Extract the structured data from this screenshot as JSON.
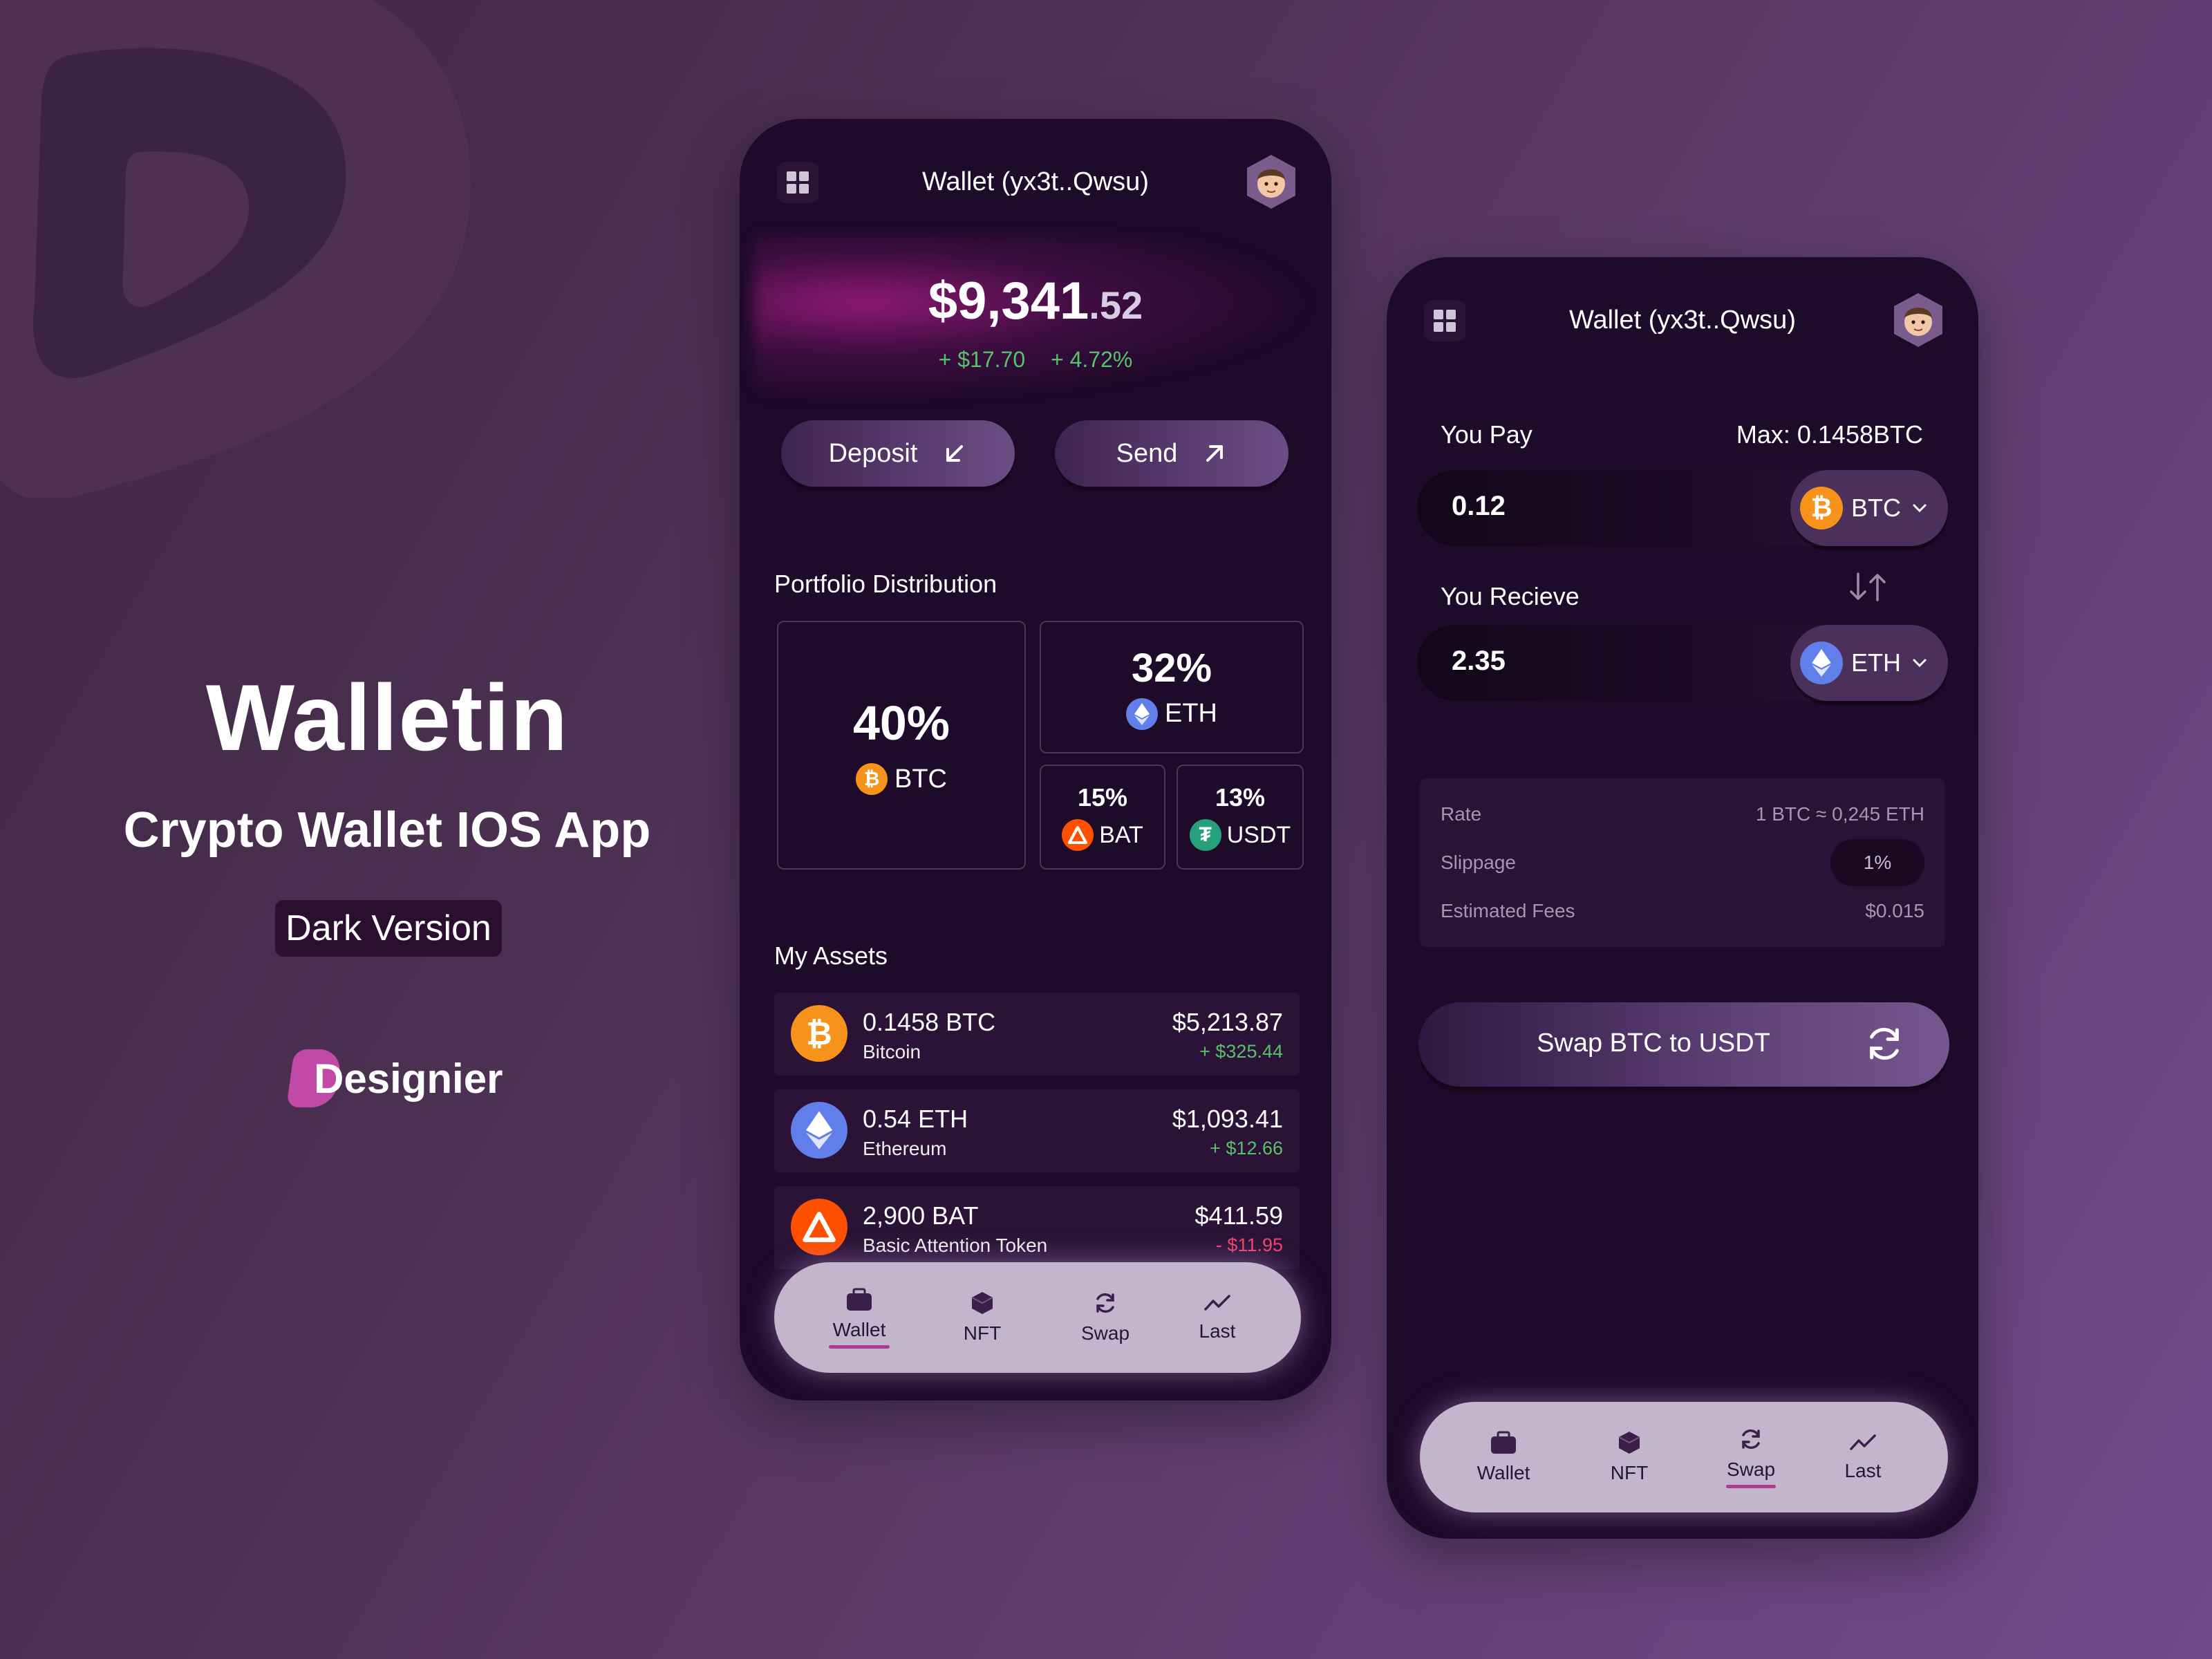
{
  "brand": {
    "title": "Walletin",
    "subtitle": "Crypto Wallet IOS App",
    "version": "Dark Version",
    "designer": "Designier"
  },
  "colors": {
    "background_start": "#3f2841",
    "background_end": "#6f4a8a",
    "phone_bg": "#1e0a29",
    "positive": "#56c26a",
    "negative": "#f0456b",
    "accent": "#b03c92",
    "btc": "#f7931a",
    "eth": "#627eea",
    "bat": "#ff5000",
    "usdt": "#26a17b"
  },
  "wallet_screen": {
    "header": {
      "title": "Wallet (yx3t..Qwsu)",
      "menu_icon": "grid-icon",
      "avatar_icon": "avatar"
    },
    "balance": {
      "main": "$9,341",
      "cents": ".52",
      "change_amount": "+ $17.70",
      "change_percent": "+ 4.72%"
    },
    "actions": {
      "deposit_label": "Deposit",
      "send_label": "Send"
    },
    "portfolio": {
      "title": "Portfolio Distribution",
      "items": [
        {
          "percent": "40%",
          "symbol": "BTC"
        },
        {
          "percent": "32%",
          "symbol": "ETH"
        },
        {
          "percent": "15%",
          "symbol": "BAT"
        },
        {
          "percent": "13%",
          "symbol": "USDT"
        }
      ]
    },
    "assets": {
      "title": "My Assets",
      "items": [
        {
          "amount": "0.1458 BTC",
          "name": "Bitcoin",
          "value": "$5,213.87",
          "change": "+ $325.44"
        },
        {
          "amount": "0.54 ETH",
          "name": "Ethereum",
          "value": "$1,093.41",
          "change": "+ $12.66"
        },
        {
          "amount": "2,900 BAT",
          "name": "Basic Attention Token",
          "value": "$411.59",
          "change": "- $11.95"
        }
      ]
    },
    "tabbar": {
      "active": "Wallet",
      "tabs": [
        "Wallet",
        "NFT",
        "Swap",
        "Last"
      ]
    }
  },
  "swap_screen": {
    "header": {
      "title": "Wallet (yx3t..Qwsu)"
    },
    "pay": {
      "label": "You Pay",
      "max": "Max: 0.1458BTC",
      "value": "0.12",
      "token": "BTC"
    },
    "receive": {
      "label": "You Recieve",
      "value": "2.35",
      "token": "ETH"
    },
    "info": {
      "rate_label": "Rate",
      "rate_value": "1 BTC ≈ 0,245 ETH",
      "slippage_label": "Slippage",
      "slippage_value": "1%",
      "fees_label": "Estimated Fees",
      "fees_value": "$0.015"
    },
    "swap_button": "Swap BTC to USDT",
    "tabbar": {
      "active": "Swap",
      "tabs": [
        "Wallet",
        "NFT",
        "Swap",
        "Last"
      ]
    }
  }
}
